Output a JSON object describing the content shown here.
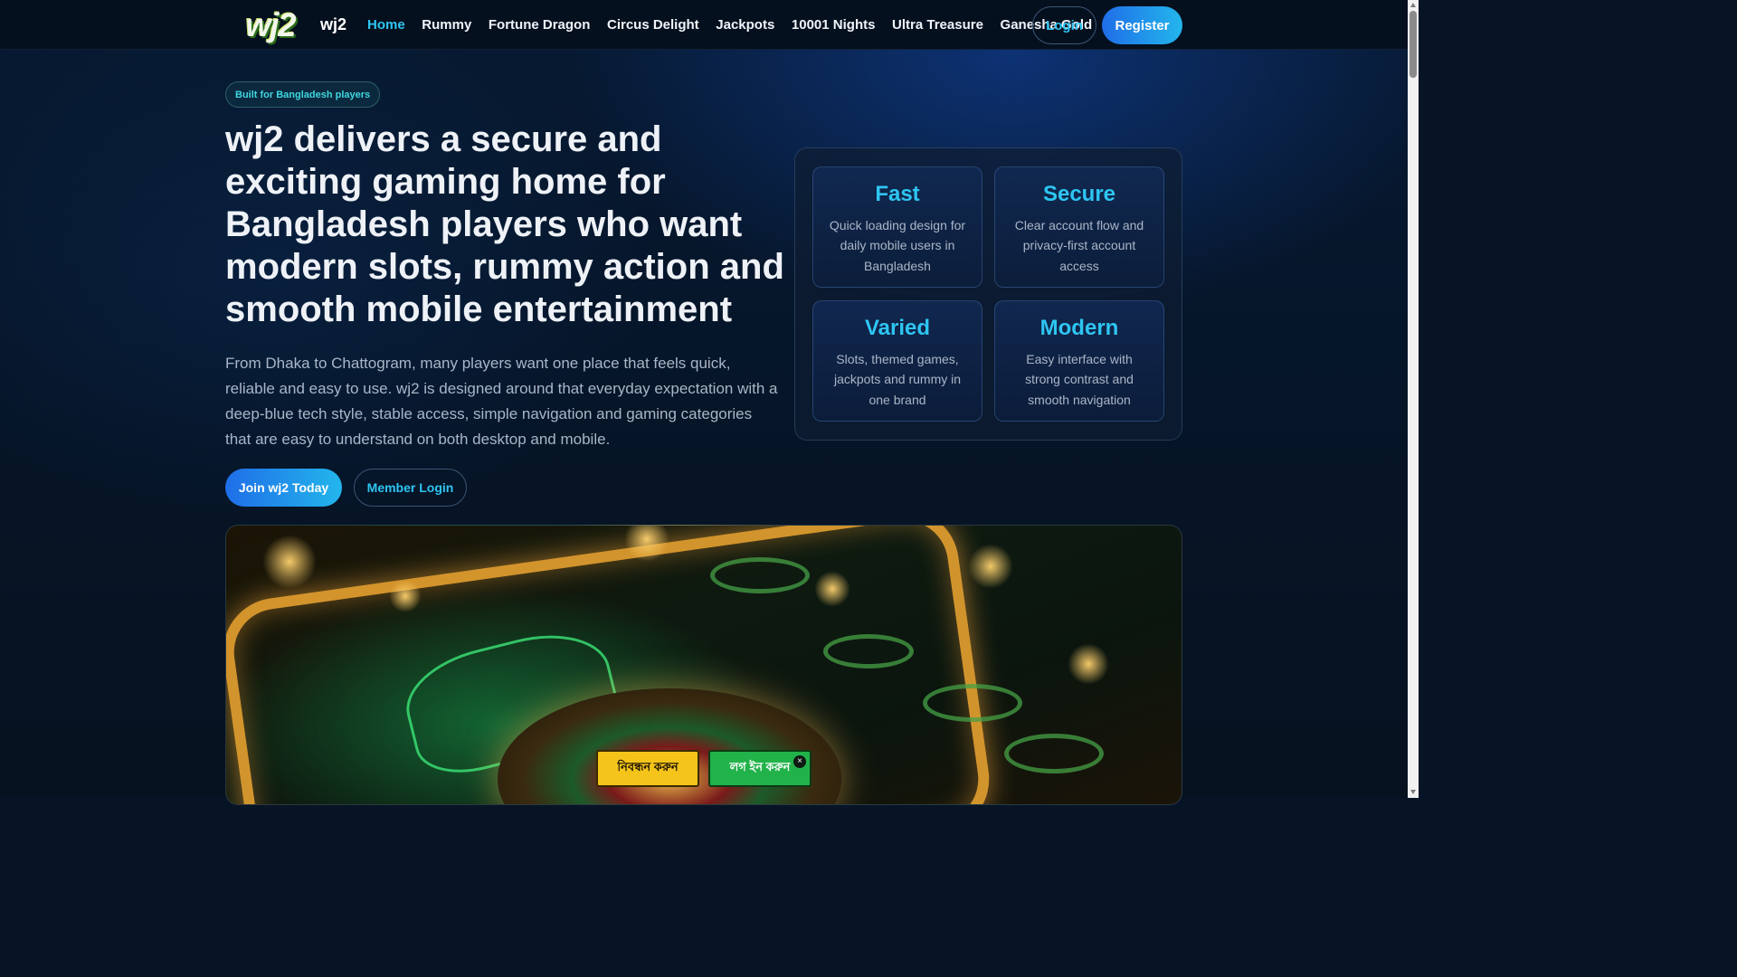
{
  "header": {
    "logo_text": "wj2",
    "brand": "wj2",
    "nav": [
      {
        "label": "Home",
        "active": true
      },
      {
        "label": "Rummy",
        "active": false
      },
      {
        "label": "Fortune Dragon",
        "active": false
      },
      {
        "label": "Circus Delight",
        "active": false
      },
      {
        "label": "Jackpots",
        "active": false
      },
      {
        "label": "10001 Nights",
        "active": false
      },
      {
        "label": "Ultra Treasure",
        "active": false
      },
      {
        "label": "Ganesha Gold",
        "active": false
      }
    ],
    "login_label": "Login",
    "register_label": "Register"
  },
  "hero": {
    "badge": "Built for Bangladesh players",
    "title": "wj2 delivers a secure and exciting gaming home for Bangladesh players who want modern slots, rummy action and smooth mobile entertainment",
    "description": "From Dhaka to Chattogram, many players want one place that feels quick, reliable and easy to use. wj2 is designed around that everyday expectation with a deep-blue tech style, stable access, simple navigation and gaming categories that are easy to understand on both desktop and mobile.",
    "join_label": "Join wj2 Today",
    "member_login_label": "Member Login"
  },
  "features": [
    {
      "title": "Fast",
      "text": "Quick loading design for daily mobile users in Bangladesh"
    },
    {
      "title": "Secure",
      "text": "Clear account flow and privacy-first account access"
    },
    {
      "title": "Varied",
      "text": "Slots, themed games, jackpots and rummy in one brand"
    },
    {
      "title": "Modern",
      "text": "Easy interface with strong contrast and smooth navigation"
    }
  ],
  "floating": {
    "register_label": "নিবন্ধন করুন",
    "login_label": "লগ ইন করুন",
    "close_glyph": "×"
  },
  "colors": {
    "accent": "#2ec5f2",
    "background": "#061426",
    "cta_gradient_start": "#1f6ee8",
    "cta_gradient_end": "#23b6ec",
    "float_register_bg": "#f5c41b",
    "float_login_bg": "#22b24a"
  }
}
